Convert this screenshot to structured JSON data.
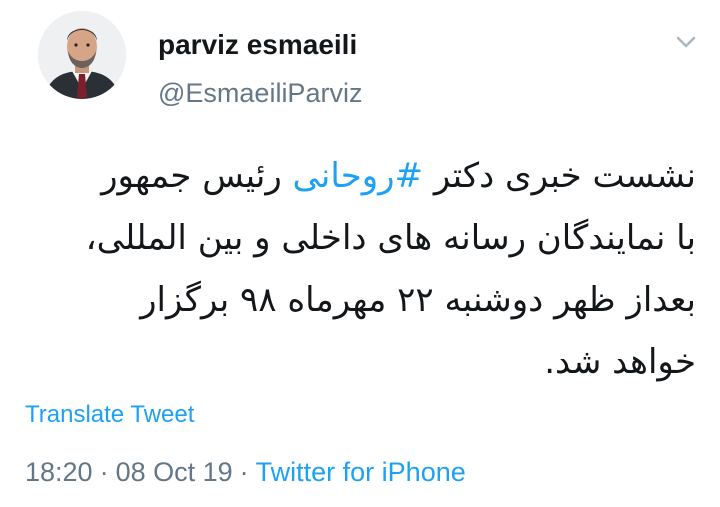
{
  "tweet": {
    "author": {
      "display_name": "parviz esmaeili",
      "handle": "@EsmaeiliParviz",
      "avatar_icon": "profile-photo"
    },
    "menu_icon": "chevron-down-icon",
    "text_lines": [
      {
        "before": "نشست خبری دکتر ",
        "hashtag": "#روحانی",
        "after": " رئیس جمهور"
      },
      {
        "text": "با نمایندگان رسانه های داخلی و بین المللی،"
      },
      {
        "text": "بعداز ظهر دوشنبه ۲۲ مهرماه ۹۸ برگزار"
      },
      {
        "text": "خواهد شد."
      }
    ],
    "translate_label": "Translate Tweet",
    "time": "18:20",
    "date": "08 Oct 19",
    "separator": "·",
    "source": "Twitter for iPhone"
  },
  "colors": {
    "link": "#1da1f2",
    "muted": "#657786",
    "text": "#14171a"
  }
}
